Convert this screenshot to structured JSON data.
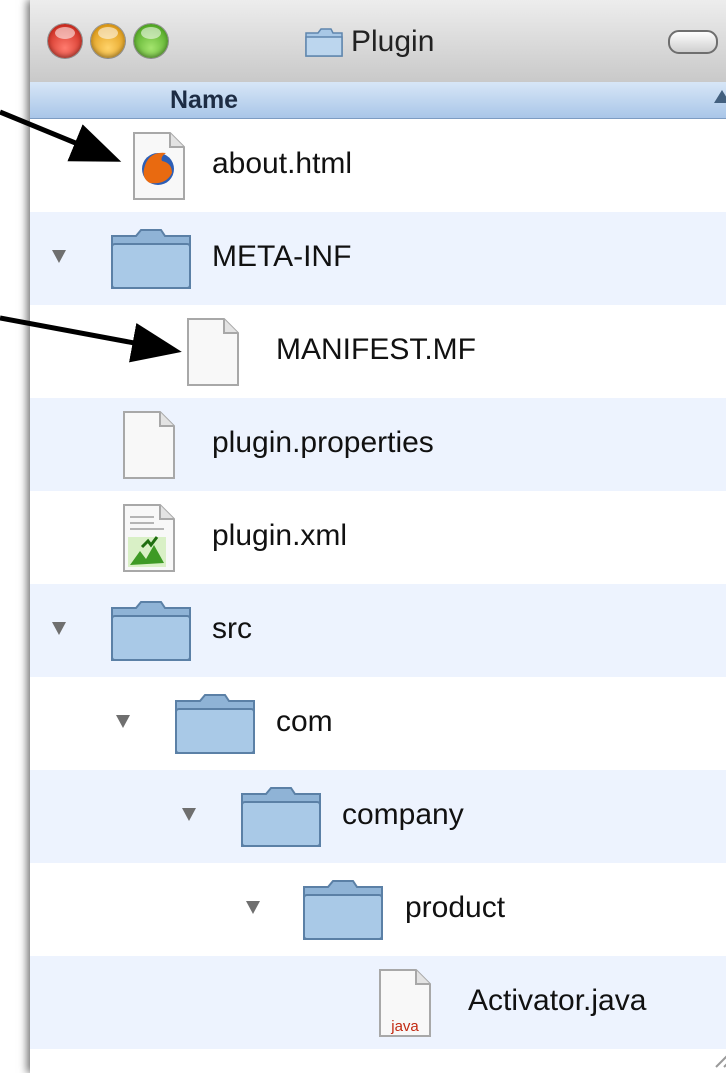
{
  "window": {
    "title": "Plugin"
  },
  "header": {
    "name_column": "Name"
  },
  "rows": [
    {
      "label": "about.html",
      "icon": "html-file-icon"
    },
    {
      "label": "META-INF",
      "icon": "folder-icon",
      "expanded": true
    },
    {
      "label": "MANIFEST.MF",
      "icon": "document-icon"
    },
    {
      "label": "plugin.properties",
      "icon": "document-icon"
    },
    {
      "label": "plugin.xml",
      "icon": "xml-file-icon"
    },
    {
      "label": "src",
      "icon": "folder-icon",
      "expanded": true
    },
    {
      "label": "com",
      "icon": "folder-icon",
      "expanded": true
    },
    {
      "label": "company",
      "icon": "folder-icon",
      "expanded": true
    },
    {
      "label": "product",
      "icon": "folder-icon",
      "expanded": true
    },
    {
      "label": "Activator.java",
      "icon": "java-file-icon",
      "badge": "java"
    }
  ],
  "colors": {
    "row_stripe": "#edf3fe",
    "header": "#a9c6e8",
    "folder": "#9fc0de"
  }
}
